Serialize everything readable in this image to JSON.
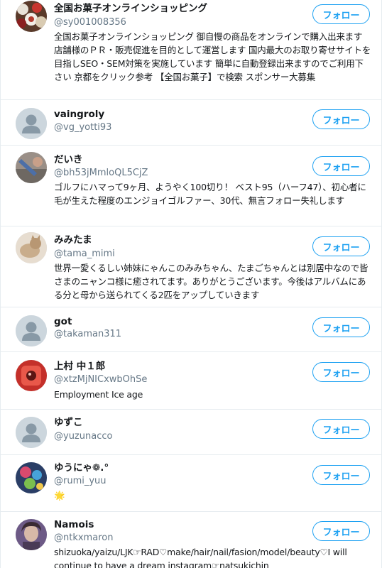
{
  "follow_label": "フォロー",
  "users": [
    {
      "name": "全国お菓子オンラインショッピング",
      "handle": "@sy001008356",
      "bio": "全国お菓子オンラインショッピング 御自慢の商品をオンラインで購入出来ます 店舗様のＰＲ・販売促進を目的として運営します 国内最大のお取り寄せサイトを目指しSEO・SEM対策を実施しています 簡単に自動登録出来ますのでご利用下さい 京都をクリック参考 【全国お菓子】で検索 スポンサー大募集",
      "avatar": "food-photo"
    },
    {
      "name": "vaingroly",
      "handle": "@vg_yotti93",
      "bio": "",
      "avatar": "default-avatar"
    },
    {
      "name": "だいき",
      "handle": "@bh53jMmloQL5CjZ",
      "bio": "ゴルフにハマって9ヶ月、ようやく100切り！ ベスト95（ハーフ47）、初心者に毛が生えた程度のエンジョイゴルファー、30代、無言フォロー失礼します",
      "avatar": "golf-photo"
    },
    {
      "name": "みみたま",
      "handle": "@tama_mimi",
      "bio": "世界一愛くるしい姉妹にゃんこのみみちゃん、たまごちゃんとは別居中なので皆さまのニャンコ様に癒されてます。ありがとうございます。今後はアルバムにある分と母から送られてくる2匹をアップしていきます",
      "avatar": "cat-photo"
    },
    {
      "name": "got",
      "handle": "@takaman311",
      "bio": "",
      "avatar": "default-avatar"
    },
    {
      "name": "上村 中１郎",
      "handle": "@xtzMjNICxwbOhSe",
      "bio": "Employment Ice age",
      "avatar": "red-photo"
    },
    {
      "name": "ゆずこ",
      "handle": "@yuzunacco",
      "bio": "",
      "avatar": "default-avatar"
    },
    {
      "name": "ゆうにゃ❁.°",
      "handle": "@rumi_yuu",
      "bio": "🌟",
      "avatar": "colorful-photo"
    },
    {
      "name": "Namois",
      "handle": "@ntkxmaron",
      "bio": "shizuoka/yaizu/LJK☞RAD♡make/hair/nail/fasion/model/beauty♡I will continue to have a dream instagram☞natsukichin",
      "avatar": "portrait-photo"
    }
  ]
}
